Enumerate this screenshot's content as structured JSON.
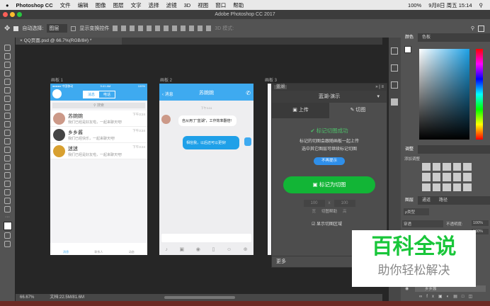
{
  "menubar": {
    "app": "Photoshop CC",
    "items": [
      "文件",
      "编辑",
      "图像",
      "图层",
      "文字",
      "选择",
      "滤镜",
      "3D",
      "视图",
      "窗口",
      "帮助"
    ],
    "battery": "100%",
    "clock": "9月8日 周五 15:14"
  },
  "window": {
    "title": "Adobe Photoshop CC 2017"
  },
  "options": {
    "auto_select": "自动选择:",
    "layer_select": "图层",
    "show_transform": "显示变换控件",
    "mode_3d": "3D 模式:"
  },
  "document": {
    "tab": "QQ页面.psd @ 66.7%(RGB/8#) *"
  },
  "artboards": {
    "a1": {
      "label": "画板 1",
      "status_left": "●●●●● 中国移动",
      "status_time": "9:41 AM",
      "status_right": "100%",
      "tab_msg": "消息",
      "tab_phone": "电话",
      "search": "搜索",
      "messages": [
        {
          "name": "苏婉婉",
          "text": "我们已经是好友啦，一起来聊天吧!",
          "time": "下午3:24"
        },
        {
          "name": "乡乡酱",
          "text": "我们已经快乐，一起来聊天吧!",
          "time": "下午3:24"
        },
        {
          "name": "迷迷",
          "text": "我们已经是好友啦，一起来聊天吧!",
          "time": "下午3:24"
        }
      ],
      "nav": [
        "消息",
        "联系人",
        "动态"
      ]
    },
    "a2": {
      "label": "画板 2",
      "back": "消息",
      "title": "苏婉婉",
      "time": "下午3:24",
      "incoming": "自从用了\"蓝湖\"，工作效率翻倍!",
      "outgoing": "相信我，以后还可以更快!"
    },
    "a3": {
      "label": "画板 3"
    }
  },
  "lanhu": {
    "title": "蓝湖",
    "project": "蓝湖-演示",
    "tab_upload": "上传",
    "tab_slice": "切图",
    "success": "标记切图成功",
    "desc1": "标记的切图会跟随画板一起上传",
    "desc2": "选中其它图层可继续标记切图",
    "no_remind": "不再提示",
    "mark_button": "标记为切图",
    "width": "100",
    "x": "x",
    "height": "100",
    "w_label": "宽",
    "h_label": "高",
    "help": "切图帮助",
    "show_area": "显示切图区域",
    "more": "更多"
  },
  "panels": {
    "color_tabs": [
      "颜色",
      "色板"
    ],
    "adjust_tab": "调整",
    "adjust_add": "添加调整",
    "layer_tabs": [
      "图层",
      "通道",
      "路径"
    ],
    "filter": "ρ类型",
    "blend": "穿透",
    "opacity_label": "不透明度:",
    "opacity": "100%",
    "fill": "100%",
    "layer_name": "乡乡酱"
  },
  "status": {
    "zoom": "66.67%",
    "doc": "文档:22.5M/81.6M"
  },
  "watermark": {
    "title": "百科全说",
    "subtitle": "助你轻松解决"
  },
  "colors": {
    "qq_blue": "#3eaaf0",
    "green": "#12b536",
    "blue_btn": "#2f8fe9"
  }
}
